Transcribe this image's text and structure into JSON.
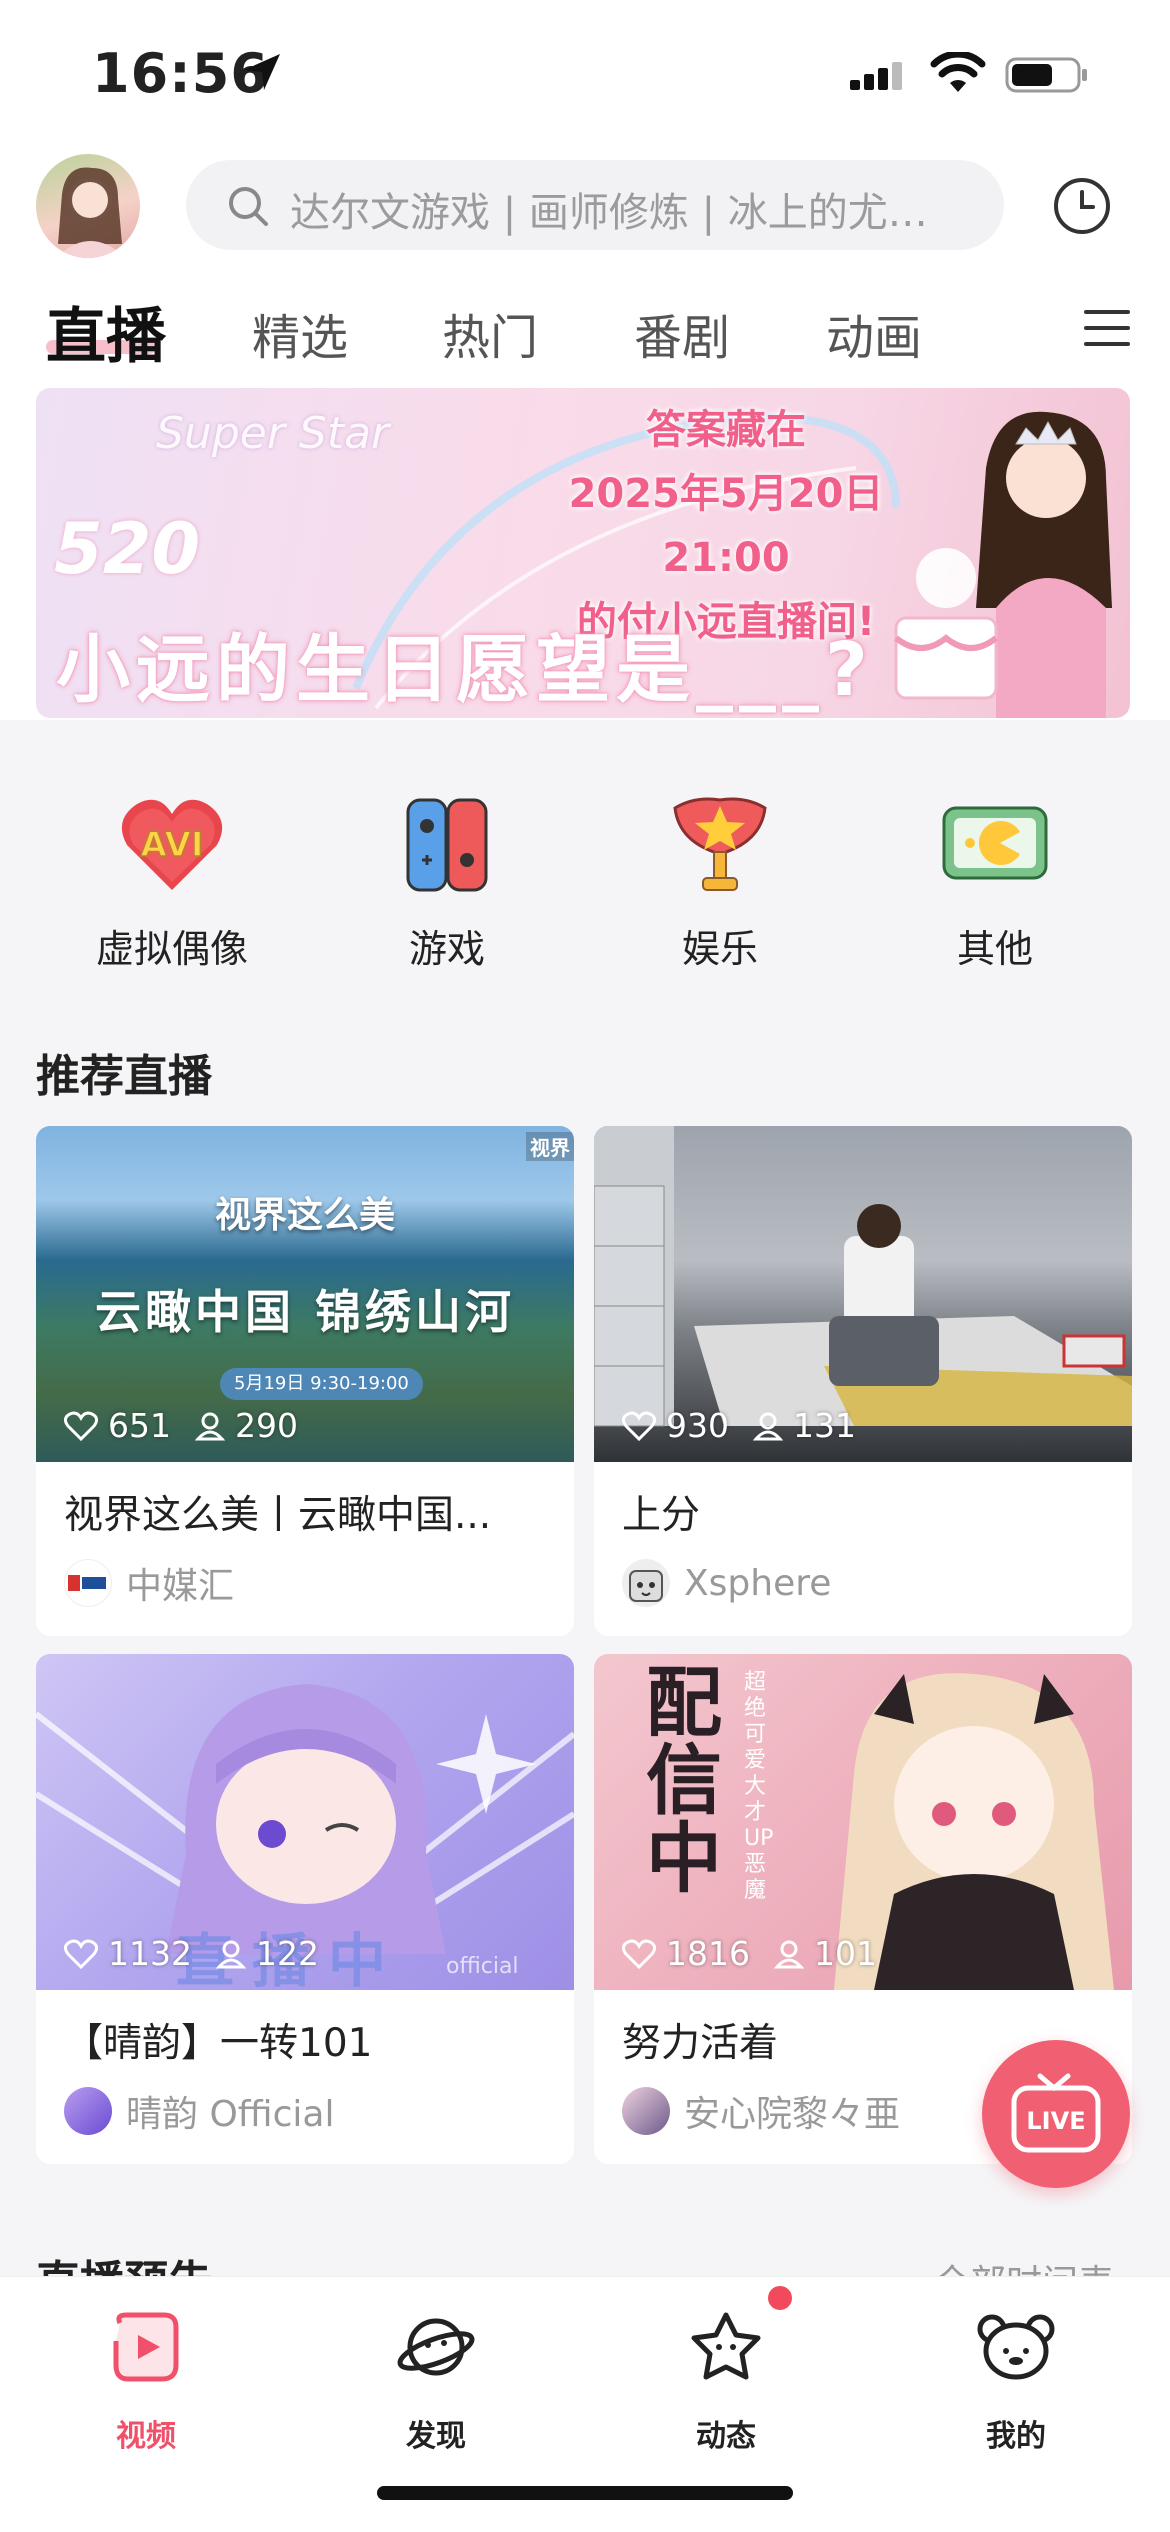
{
  "status_bar": {
    "time": "16:56"
  },
  "header": {
    "search_placeholder": "达尔文游戏 | 画师修炼 | 冰上的尤…"
  },
  "tabs": [
    {
      "label": "直播",
      "active": true
    },
    {
      "label": "精选"
    },
    {
      "label": "热门"
    },
    {
      "label": "番剧"
    },
    {
      "label": "动画"
    }
  ],
  "banner": {
    "line1": "答案藏在",
    "line2": "2025年5月20日21:00",
    "line3": "的付小远直播间!",
    "badge": "520",
    "wordmark": "Super Star",
    "wish": "小远的生日愿望是___?"
  },
  "categories": [
    {
      "label": "虚拟偶像",
      "icon": "avi-heart-icon"
    },
    {
      "label": "游戏",
      "icon": "game-console-icon"
    },
    {
      "label": "娱乐",
      "icon": "trophy-star-icon"
    },
    {
      "label": "其他",
      "icon": "pacman-screen-icon"
    }
  ],
  "recommended": {
    "title": "推荐直播",
    "cards": [
      {
        "likes": "651",
        "viewers": "290",
        "title": "视界这么美丨云瞰中国...",
        "owner": "中媒汇",
        "thumb_title": "视界这么美",
        "thumb_sub": "云瞰中国 锦绣山河",
        "thumb_date": "5月19日 9:30-19:00",
        "thumb_tag": "视界"
      },
      {
        "likes": "930",
        "viewers": "131",
        "title": "上分",
        "owner": "Xsphere"
      },
      {
        "likes": "1132",
        "viewers": "122",
        "title": "【晴韵】一转101",
        "owner": "晴韵 Official",
        "thumb_overlay": "直播中",
        "thumb_tag": "official"
      },
      {
        "likes": "1816",
        "viewers": "101",
        "title": "努力活着",
        "owner": "安心院黎々亜",
        "thumb_big": "配信中",
        "thumb_vertical": "超绝可爱大才UP恶魔"
      }
    ]
  },
  "next_section": {
    "title": "直播预告",
    "link": "全部时间表"
  },
  "fab": {
    "label": "LIVE"
  },
  "bottom_nav": [
    {
      "label": "视频",
      "active": true
    },
    {
      "label": "发现"
    },
    {
      "label": "动态",
      "badge": true
    },
    {
      "label": "我的"
    }
  ],
  "colors": {
    "accent": "#f0506a",
    "tab_underline": "#f4a4b4"
  }
}
